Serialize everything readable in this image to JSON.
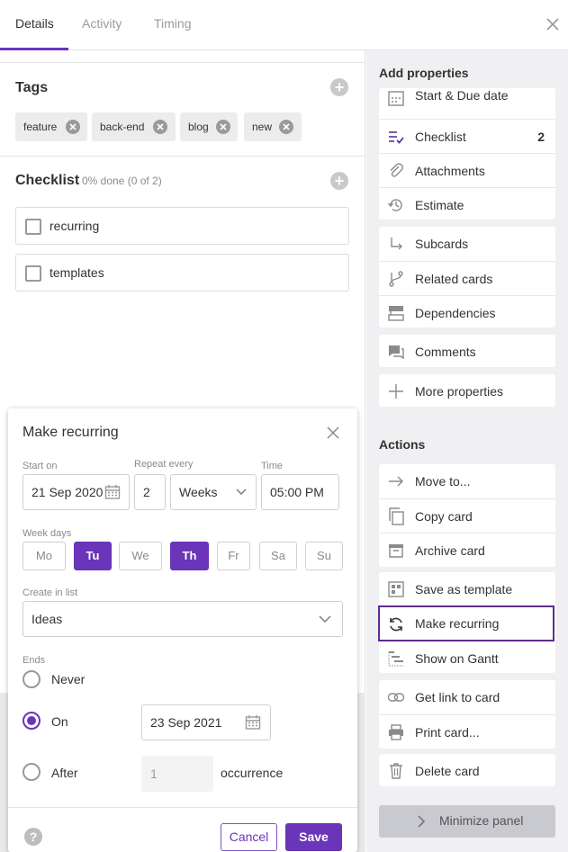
{
  "tabs": [
    {
      "label": "Details"
    },
    {
      "label": "Activity"
    },
    {
      "label": "Timing"
    }
  ],
  "tags": {
    "title": "Tags",
    "items": [
      "feature",
      "back-end",
      "blog",
      "new"
    ]
  },
  "checklist": {
    "title": "Checklist",
    "progress": "0% done (0 of 2)",
    "items": [
      "recurring",
      "templates"
    ]
  },
  "dialog": {
    "title": "Make recurring",
    "start_label": "Start on",
    "start_value": "21 Sep 2020",
    "repeat_label": "Repeat every",
    "repeat_number": "2",
    "repeat_unit": "Weeks",
    "time_label": "Time",
    "time_value": "05:00 PM",
    "weekdays_label": "Week days",
    "weekdays": [
      {
        "label": "Mo",
        "selected": false
      },
      {
        "label": "Tu",
        "selected": true
      },
      {
        "label": "We",
        "selected": false
      },
      {
        "label": "Th",
        "selected": true
      },
      {
        "label": "Fr",
        "selected": false
      },
      {
        "label": "Sa",
        "selected": false
      },
      {
        "label": "Su",
        "selected": false
      }
    ],
    "list_label": "Create in list",
    "list_value": "Ideas",
    "ends_label": "Ends",
    "ends_never": "Never",
    "ends_on": "On",
    "ends_on_date": "23 Sep 2021",
    "ends_after": "After",
    "ends_after_count_placeholder": "1",
    "occurrence_label": "occurrence",
    "ends_selected": "On",
    "cancel_label": "Cancel",
    "save_label": "Save",
    "help_label": "?"
  },
  "panel": {
    "add_properties": "Add properties",
    "props_group1": [
      {
        "label": "Start & Due date",
        "icon": "calendar-icon"
      },
      {
        "label": "Checklist",
        "icon": "checklist-icon",
        "count": "2"
      },
      {
        "label": "Attachments",
        "icon": "paperclip-icon"
      },
      {
        "label": "Estimate",
        "icon": "history-icon"
      }
    ],
    "props_group2": [
      {
        "label": "Subcards",
        "icon": "subcard-arrow-icon"
      },
      {
        "label": "Related cards",
        "icon": "branch-icon"
      },
      {
        "label": "Dependencies",
        "icon": "dependencies-icon"
      }
    ],
    "comments": "Comments",
    "more_properties": "More properties",
    "actions": "Actions",
    "actions_group1": [
      "Move to...",
      "Copy card",
      "Archive card"
    ],
    "actions_group2": [
      "Save as template",
      "Make recurring",
      "Show on Gantt"
    ],
    "actions_group3": [
      "Get link to card",
      "Print card..."
    ],
    "delete_card": "Delete card",
    "minimize": "Minimize panel"
  },
  "colors": {
    "accent": "#6a35b8",
    "highlight_border": "#5b2d8f",
    "panel_bg": "#f0f0f3"
  }
}
